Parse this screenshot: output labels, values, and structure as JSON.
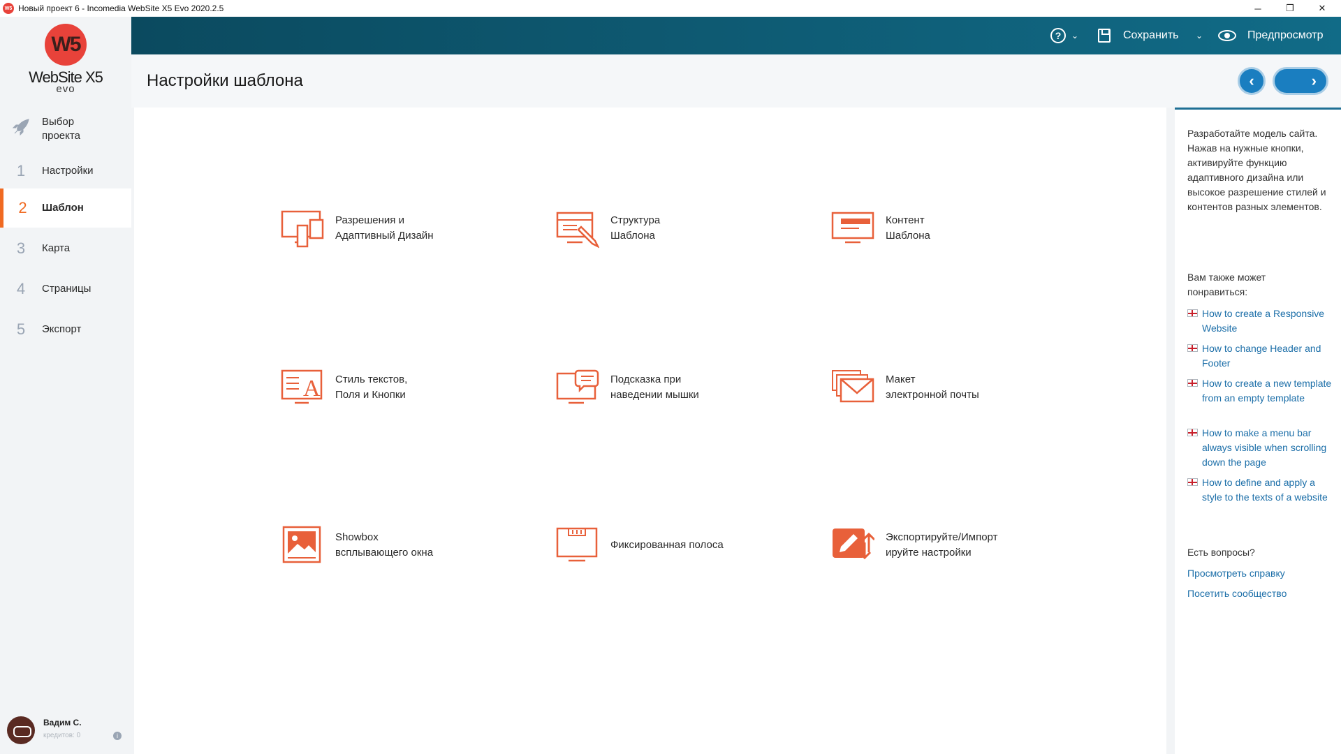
{
  "window": {
    "title": "Новый проект 6 - Incomedia WebSite X5 Evo 2020.2.5",
    "icon_text": "W5",
    "controls": [
      "─",
      "❐",
      "✕"
    ]
  },
  "logo": {
    "mark": "W5",
    "name": "WebSite X5",
    "edition": "evo"
  },
  "sidebar": {
    "project_label": "Выбор проекта",
    "items": [
      {
        "num": "1",
        "label": "Настройки"
      },
      {
        "num": "2",
        "label": "Шаблон"
      },
      {
        "num": "3",
        "label": "Карта"
      },
      {
        "num": "4",
        "label": "Страницы"
      },
      {
        "num": "5",
        "label": "Экспорт"
      }
    ],
    "active_index": 1
  },
  "user": {
    "name": "Вадим С.",
    "credits": "кредитов: 0",
    "info": "i"
  },
  "toolbar": {
    "help": "?",
    "save_label": "Сохранить",
    "preview_label": "Предпросмотр",
    "chevron": "⌄"
  },
  "page": {
    "title": "Настройки шаблона",
    "prev": "‹",
    "next": "›"
  },
  "tiles": [
    {
      "id": "resolutions",
      "icon": "devices-icon",
      "line1": "Разрешения и",
      "line2": "Адаптивный Дизайн"
    },
    {
      "id": "structure",
      "icon": "template-structure-icon",
      "line1": "Структура",
      "line2": "Шаблона"
    },
    {
      "id": "content",
      "icon": "template-content-icon",
      "line1": "Контент",
      "line2": "Шаблона"
    },
    {
      "id": "text-style",
      "icon": "text-style-icon",
      "line1": "Стиль текстов,",
      "line2": "Поля и Кнопки"
    },
    {
      "id": "tooltip",
      "icon": "tooltip-icon",
      "line1": "Подсказка при",
      "line2": "наведении мышки"
    },
    {
      "id": "email",
      "icon": "email-template-icon",
      "line1": "Макет",
      "line2": "электронной почты"
    },
    {
      "id": "showbox",
      "icon": "showbox-icon",
      "line1": "Showbox",
      "line2": "всплывающего окна"
    },
    {
      "id": "sticky-bar",
      "icon": "sticky-bar-icon",
      "line1": "Фиксированная полоса",
      "line2": ""
    },
    {
      "id": "export-import",
      "icon": "export-import-icon",
      "line1": "Экспортируйте/Импорт",
      "line2": "ируйте настройки"
    }
  ],
  "help": {
    "description": "Разработайте модель сайта. Нажав на нужные кнопки, активируйте функцию адаптивного дизайна или высокое разрешение стилей и контентов разных элементов.",
    "also_like": "Вам также может понравиться:",
    "links": [
      "How to create a Responsive Website",
      "How to change Header and Footer",
      "How to create a new template from an empty template",
      "How to make a menu bar always visible when scrolling down the page",
      "How to define and apply a style to the texts of a website"
    ],
    "questions": "Есть вопросы?",
    "view_help": "Просмотреть справку",
    "visit_community": "Посетить сообщество"
  },
  "colors": {
    "accent": "#e8603a",
    "active": "#f06a22",
    "toolbar": "#0b4a5f",
    "link": "#1b6ea8",
    "nav_button": "#1a7ec0"
  }
}
